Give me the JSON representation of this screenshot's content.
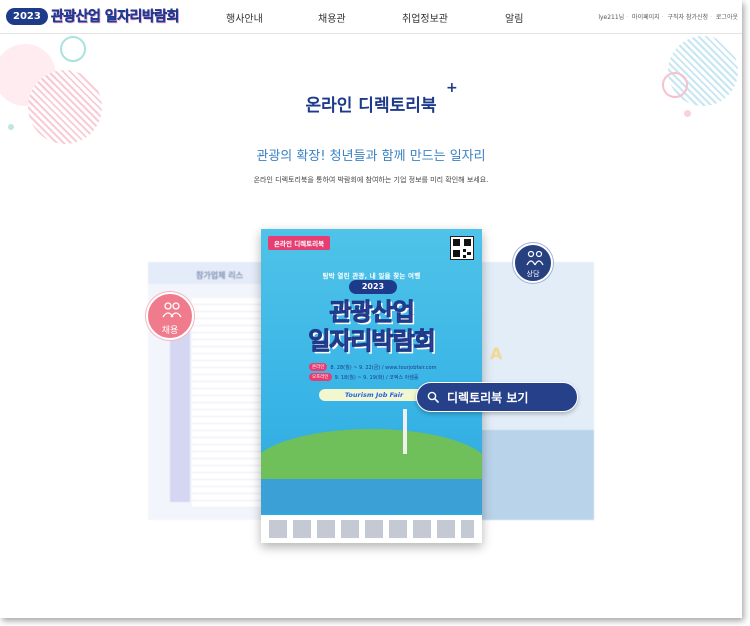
{
  "header": {
    "logo_year": "2023",
    "logo_title": "관광산업 일자리박람회",
    "nav": [
      "행사안내",
      "채용관",
      "취업정보관",
      "알림"
    ],
    "util": [
      "lye211님",
      "마이페이지",
      "구직자 참가신청",
      "로그아웃"
    ]
  },
  "main": {
    "title": "온라인 디렉토리북",
    "subtitle": "관광의 확장! 청년들과 함께 만드는 일자리",
    "description": "온라인 디렉토리북을 통하여 박람회에 참여하는 기업 정보를 미리 확인해 보세요.",
    "left_page_title": "참가업체 리스",
    "right_page_big": "A"
  },
  "badges": {
    "hire": "채용",
    "consult": "상담"
  },
  "poster": {
    "tag": "온라인 디렉토리북",
    "tagline": "탐박 열린 관광, 내 일을 찾는 여행",
    "year": "2023",
    "title_line1": "관광산업",
    "title_line2": "일자리박람회",
    "online_label": "온라인",
    "online_text": "8. 28(월) ~ 9. 22(금) / www.tourjobfair.com",
    "offline_label": "오프라인",
    "offline_text": "9. 18(월) ~ 9. 19(화) / 코엑스 아셈홀",
    "band": "Tourism Job Fair"
  },
  "cta": {
    "label": "디렉토리북 보기",
    "icon": "magnifier-icon"
  },
  "colors": {
    "brand_navy": "#1e3a8a",
    "cta_bg": "#26408a",
    "accent_pink": "#ec4899",
    "subtitle_blue": "#3b82c4",
    "poster_sky": "#4fc3e8",
    "hire_badge": "#ef7b8c",
    "consult_badge": "#27407f"
  }
}
